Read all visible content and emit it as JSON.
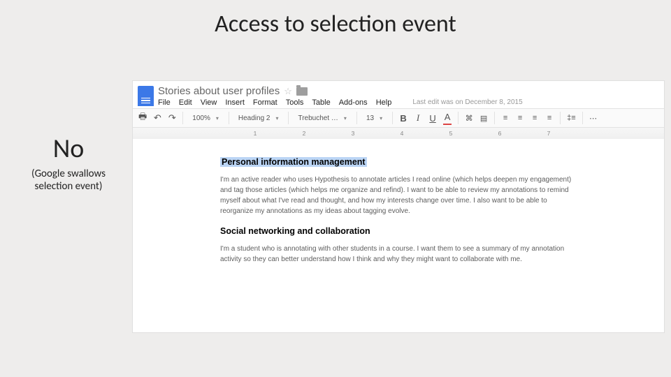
{
  "slide": {
    "title": "Access to selection event",
    "answer": "No",
    "caption": "(Google swallows selection event)"
  },
  "gdoc": {
    "title": "Stories about user profiles",
    "last_edit": "Last edit was on December 8, 2015",
    "menus": [
      "File",
      "Edit",
      "View",
      "Insert",
      "Format",
      "Tools",
      "Table",
      "Add-ons",
      "Help"
    ],
    "zoom": "100%",
    "style": "Heading 2",
    "font": "Trebuchet …",
    "size": "13",
    "ruler": [
      "1",
      "2",
      "3",
      "4",
      "5",
      "6",
      "7"
    ],
    "sections": [
      {
        "heading": "Personal information management",
        "selected": true,
        "body": "I'm an active reader who uses Hypothesis to annotate articles I read online (which helps deepen my engagement) and tag those articles (which helps me organize and refind). I want to be able to review my annotations to remind myself about what I've read and thought, and how my interests change over time. I also want to be able to reorganize my annotations as my ideas about tagging evolve."
      },
      {
        "heading": "Social networking and collaboration",
        "selected": false,
        "body": "I'm a student who is annotating with other students in a course. I want them to see a summary of my annotation activity so they can better understand how I think and why they might want to collaborate with me."
      }
    ]
  }
}
